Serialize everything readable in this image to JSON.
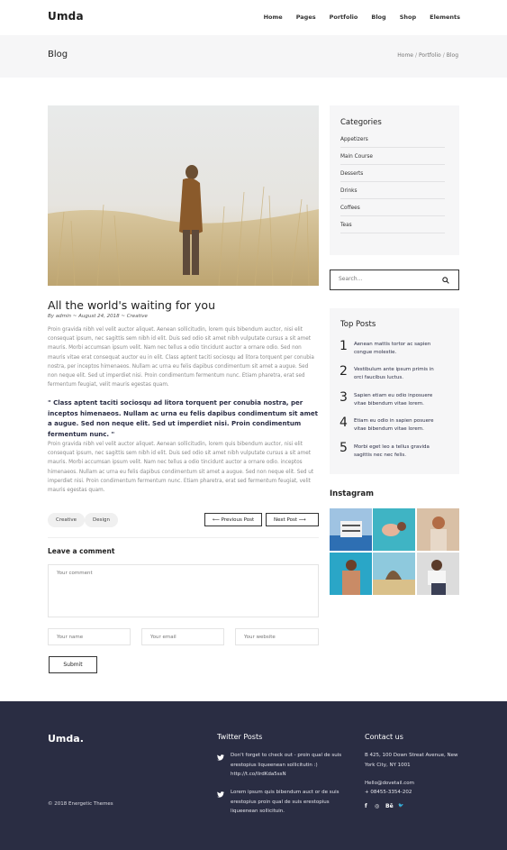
{
  "header": {
    "logo": "Umda",
    "nav": [
      "Home",
      "Pages",
      "Portfolio",
      "Blog",
      "Shop",
      "Elements"
    ]
  },
  "titleband": {
    "title": "Blog",
    "breadcrumbs": [
      "Home",
      "Portfolio",
      "Blog"
    ]
  },
  "post": {
    "title": "All the world's waiting for you",
    "meta": "By admin ~ August 24, 2018 ~ Creative",
    "para1": "Proin gravida nibh vel velit auctor aliquet. Aenean sollicitudin, lorem quis bibendum auctor, nisi elit consequat ipsum, nec sagittis sem nibh id elit. Duis sed odio sit amet nibh vulputate cursus a sit amet mauris. Morbi accumsan ipsum velit. Nam nec tellus a odio tincidunt auctor a ornare odio. Sed non mauris vitae erat consequat auctor eu in elit. Class aptent taciti sociosqu ad litora torquent per conubia nostra, per inceptos himenaeos. Nullam ac urna eu felis dapibus condimentum sit amet a augue. Sed non neque elit. Sed ut imperdiet nisi. Proin condimentum fermentum nunc. Etiam pharetra, erat sed fermentum feugiat, velit mauris egestas quam.",
    "quote": "\" Class aptent taciti sociosqu ad litora torquent per conubia nostra, per inceptos himenaeos. Nullam ac urna eu felis dapibus condimentum sit amet a augue. Sed non neque elit. Sed ut imperdiet nisi. Proin condimentum fermentum nunc. \"",
    "para2": "Proin gravida nibh vel velit auctor aliquet. Aenean sollicitudin, lorem quis bibendum auctor, nisi elit consequat ipsum, nec sagittis sem nibh id elit. Duis sed odio sit amet nibh vulputate cursus a sit amet mauris. Morbi accumsan ipsum velit. Nam nec tellus a odio tincidunt auctor a ornare odio. inceptos himenaeos. Nullam ac urna eu felis dapibus condimentum sit amet a augue. Sed non neque elit. Sed ut imperdiet nisi. Proin condimentum fermentum nunc. Etiam pharetra, erat sed fermentum feugiat, velit mauris egestas quam.",
    "tags": [
      "Creative",
      "Design"
    ],
    "prev_label": "Previous Post",
    "next_label": "Next Post"
  },
  "comment_form": {
    "title": "Leave a comment",
    "comment_placeholder": "Your comment",
    "name_placeholder": "Your name",
    "email_placeholder": "Your email",
    "website_placeholder": "Your website",
    "submit_label": "Submit"
  },
  "sidebar": {
    "categories_title": "Categories",
    "categories": [
      "Appetizers",
      "Main Course",
      "Desserts",
      "Drinks",
      "Coffees",
      "Teas"
    ],
    "search_placeholder": "Search...",
    "top_posts_title": "Top Posts",
    "top_posts": [
      {
        "num": "1",
        "text": "Aenean mattis tortor ac sapien congue molestie."
      },
      {
        "num": "2",
        "text": "Vestibulum ante ipsum primis in orci faucibus luctus."
      },
      {
        "num": "3",
        "text": "Sapien etiam eu odio inposuere vitae bibendum vitae lorem."
      },
      {
        "num": "4",
        "text": "Etiam eu odio in sapien posuere vitae bibendum vitae lorem."
      },
      {
        "num": "5",
        "text": "Morbi eget leo a tellus gravida sagittis nec nec felis."
      }
    ],
    "instagram_title": "Instagram"
  },
  "footer": {
    "logo": "Umda.",
    "copyright": "© 2018 Energetic Themes",
    "twitter_title": "Twitter Posts",
    "tweets": [
      "Don't forget to check out - proin qual de suis erestopius liqueenean sollicitutin :) http://t.co/lIrdKda5ssN",
      "Lorem ipsum quis bibendum auct or de suis erestopius proin qual de suis erestopius liqueenean sollicituin."
    ],
    "contact_title": "Contact us",
    "address": "B 425, 100 Down Streat  Avenue, New York City, NY 1001",
    "email": "Hello@dovetail.com",
    "phone": "+ 08455-3354-202",
    "social": [
      "f",
      "◎",
      "Bē",
      "🐦"
    ]
  }
}
